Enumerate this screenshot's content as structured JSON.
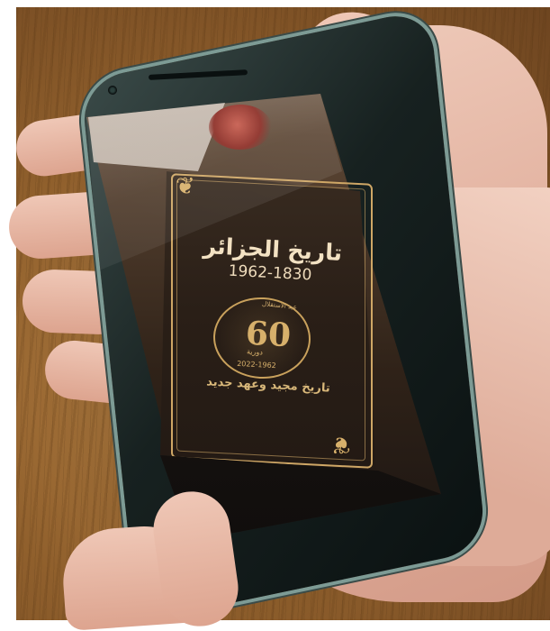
{
  "book_cover": {
    "title": "تاريخ الجزائر",
    "years": "1962-1830",
    "emblem": {
      "top_text": "عيد الاستقلال",
      "number": "60",
      "subtext": "دورية",
      "range": "2022-1962"
    },
    "subtitle": "تاريخ مجيد وعهد جديد"
  },
  "colors": {
    "accent_gold": "#d7b06b",
    "title_text": "#f3e2c3",
    "screen_dark": "#2a1f17",
    "table_wood": "#8f5f2c",
    "skin": "#e3b3a1"
  }
}
